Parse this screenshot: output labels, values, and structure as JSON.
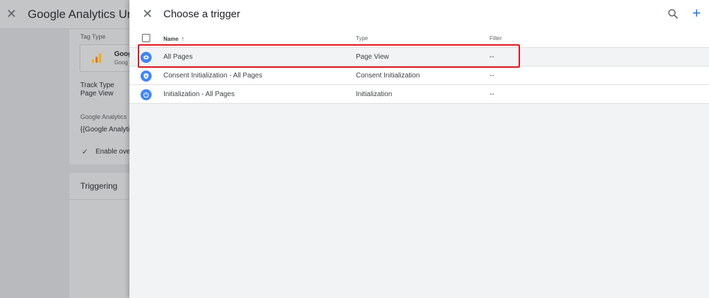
{
  "background": {
    "close_glyph": "✕",
    "title": "Google Analytics Univers",
    "tag_type_label": "Tag Type",
    "tag_name": "Goog",
    "tag_sub": "Goog",
    "track_type_label": "Track Type",
    "track_type_value": "Page View",
    "ga_label": "Google Analytics",
    "ga_value": "{{Google Analytic",
    "enable_override": "Enable over",
    "triggering_title": "Triggering",
    "ga_bar_colors": [
      "#f9ab00",
      "#e37400",
      "#f9ab00"
    ]
  },
  "panel": {
    "title": "Choose a trigger",
    "close_glyph": "✕",
    "add_glyph": "+",
    "accent": "#1a73e8"
  },
  "table": {
    "headers": {
      "name": "Name",
      "name_sort": "↑",
      "type": "Type",
      "filter": "Filter"
    },
    "rows": [
      {
        "icon": "eye-icon",
        "name": "All Pages",
        "type": "Page View",
        "filter": "--"
      },
      {
        "icon": "shield-icon",
        "name": "Consent Initialization - All Pages",
        "type": "Consent Initialization",
        "filter": "--"
      },
      {
        "icon": "power-icon",
        "name": "Initialization - All Pages",
        "type": "Initialization",
        "filter": "--"
      }
    ]
  },
  "highlight_color": "#e0141b"
}
